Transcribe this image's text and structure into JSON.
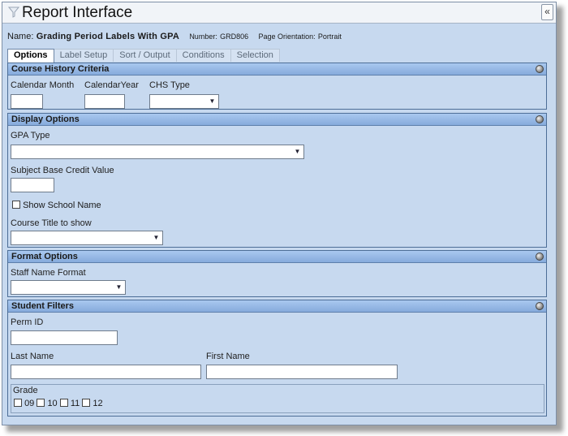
{
  "window": {
    "title": "Report Interface",
    "collapse_icon": "double-chevron-left-icon"
  },
  "report": {
    "name_label": "Name:",
    "name_value": "Grading Period Labels With GPA",
    "number_label": "Number:",
    "number_value": "GRD806",
    "orientation_label": "Page Orientation:",
    "orientation_value": "Portrait"
  },
  "tabs": [
    {
      "label": "Options",
      "active": true
    },
    {
      "label": "Label Setup",
      "active": false
    },
    {
      "label": "Sort / Output",
      "active": false
    },
    {
      "label": "Conditions",
      "active": false
    },
    {
      "label": "Selection",
      "active": false
    }
  ],
  "course_history": {
    "title": "Course History Criteria",
    "calendar_month_label": "Calendar Month",
    "calendar_year_label": "CalendarYear",
    "chs_type_label": "CHS Type"
  },
  "display_options": {
    "title": "Display Options",
    "gpa_type_label": "GPA Type",
    "subject_base_credit_label": "Subject Base Credit Value",
    "show_school_name_label": "Show School Name",
    "course_title_label": "Course Title to show"
  },
  "format_options": {
    "title": "Format Options",
    "staff_name_format_label": "Staff Name Format"
  },
  "student_filters": {
    "title": "Student Filters",
    "perm_id_label": "Perm ID",
    "last_name_label": "Last Name",
    "first_name_label": "First Name",
    "grade_label": "Grade",
    "grades": [
      "09",
      "10",
      "11",
      "12"
    ]
  },
  "colors": {
    "panel_bg": "#c7d9ef",
    "section_header": "#86abdc",
    "section_border": "#4d6e97"
  }
}
